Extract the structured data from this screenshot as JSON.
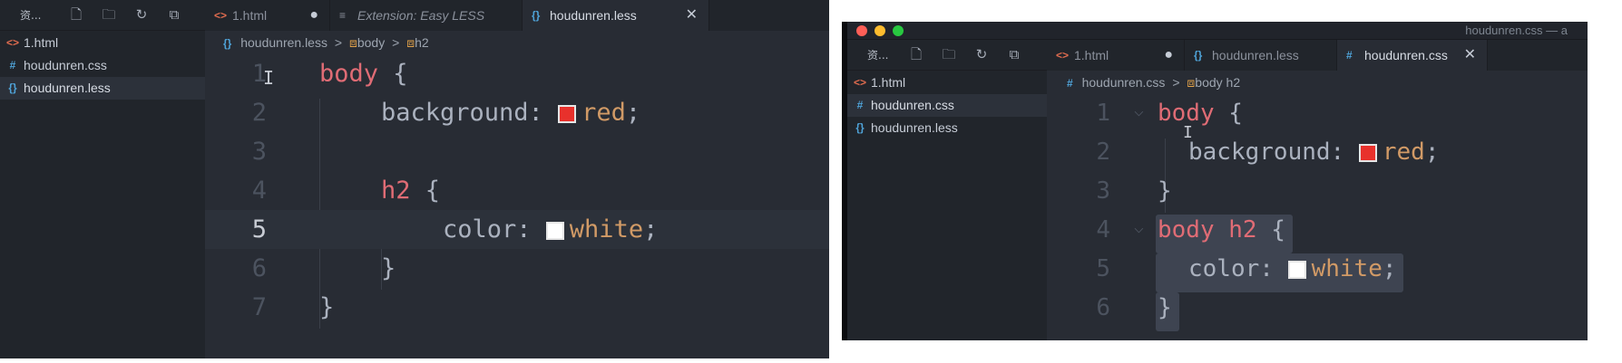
{
  "left": {
    "sidebar": {
      "title": "资...",
      "files": [
        {
          "name": "1.html",
          "icon": "<>",
          "icon_color": "#e06c4f"
        },
        {
          "name": "houdunren.css",
          "icon": "#",
          "icon_color": "#4fa3d8"
        },
        {
          "name": "houdunren.less",
          "icon": "{}",
          "icon_color": "#4fa3d8",
          "active": true
        }
      ]
    },
    "tabs": [
      {
        "label": "1.html",
        "icon": "<>",
        "icon_color": "#e06c4f",
        "status": "●"
      },
      {
        "label": "Extension: Easy LESS",
        "icon": "≡",
        "icon_color": "#8b919c",
        "italic": true
      },
      {
        "label": "houdunren.less",
        "icon": "{}",
        "icon_color": "#4fa3d8",
        "active": true,
        "status": "✕"
      }
    ],
    "breadcrumb": {
      "file": "houdunren.less",
      "sym1": "body",
      "sym2": "h2",
      "sep": ">"
    },
    "code": [
      {
        "n": "1",
        "indent": 0,
        "parts": [
          {
            "t": "body",
            "c": "tag"
          },
          {
            "t": " {",
            "c": "punct"
          }
        ]
      },
      {
        "n": "2",
        "indent": 1,
        "parts": [
          {
            "t": "background: ",
            "c": "prop"
          },
          {
            "sw": "#e8312c"
          },
          {
            "t": "red",
            "c": "val"
          },
          {
            "t": ";",
            "c": "punct"
          }
        ]
      },
      {
        "n": "3",
        "indent": 0,
        "parts": []
      },
      {
        "n": "4",
        "indent": 1,
        "parts": [
          {
            "t": "h2",
            "c": "tag"
          },
          {
            "t": " {",
            "c": "punct"
          }
        ]
      },
      {
        "n": "5",
        "indent": 2,
        "parts": [
          {
            "t": "color: ",
            "c": "prop"
          },
          {
            "sw": "#ffffff"
          },
          {
            "t": "white",
            "c": "val"
          },
          {
            "t": ";",
            "c": "punct"
          }
        ],
        "current": true
      },
      {
        "n": "6",
        "indent": 1,
        "parts": [
          {
            "t": "}",
            "c": "punct"
          }
        ]
      },
      {
        "n": "7",
        "indent": 0,
        "parts": [
          {
            "t": "}",
            "c": "punct"
          }
        ]
      }
    ]
  },
  "right": {
    "window_title": "houdunren.css — a",
    "sidebar": {
      "title": "资...",
      "files": [
        {
          "name": "1.html",
          "icon": "<>",
          "icon_color": "#e06c4f"
        },
        {
          "name": "houdunren.css",
          "icon": "#",
          "icon_color": "#4fa3d8",
          "active": true
        },
        {
          "name": "houdunren.less",
          "icon": "{}",
          "icon_color": "#4fa3d8"
        }
      ]
    },
    "tabs": [
      {
        "label": "1.html",
        "icon": "<>",
        "icon_color": "#e06c4f",
        "status": "●"
      },
      {
        "label": "houdunren.less",
        "icon": "{}",
        "icon_color": "#4fa3d8"
      },
      {
        "label": "houdunren.css",
        "icon": "#",
        "icon_color": "#4fa3d8",
        "active": true,
        "status": "✕"
      }
    ],
    "breadcrumb": {
      "file": "houdunren.css",
      "sym1": "body h2",
      "sep": ">"
    },
    "code": [
      {
        "n": "1",
        "indent": 0,
        "parts": [
          {
            "t": "body",
            "c": "tag"
          },
          {
            "t": " {",
            "c": "punct"
          }
        ]
      },
      {
        "n": "2",
        "indent": 1,
        "parts": [
          {
            "t": "background: ",
            "c": "prop"
          },
          {
            "sw": "#e8312c"
          },
          {
            "t": "red",
            "c": "val"
          },
          {
            "t": ";",
            "c": "punct"
          }
        ]
      },
      {
        "n": "3",
        "indent": 0,
        "parts": [
          {
            "t": "}",
            "c": "punct"
          }
        ]
      },
      {
        "n": "4",
        "indent": 0,
        "parts": [
          {
            "t": "body h2",
            "c": "tag"
          },
          {
            "t": " {",
            "c": "punct"
          }
        ],
        "selected": true
      },
      {
        "n": "5",
        "indent": 1,
        "parts": [
          {
            "t": "color: ",
            "c": "prop"
          },
          {
            "sw": "#ffffff"
          },
          {
            "t": "white",
            "c": "val"
          },
          {
            "t": ";",
            "c": "punct"
          }
        ],
        "selected": true
      },
      {
        "n": "6",
        "indent": 0,
        "parts": [
          {
            "t": "}",
            "c": "punct"
          }
        ],
        "selected": true
      }
    ]
  },
  "colors": {
    "accent_active_tab": "#282c34",
    "tag": "#e06c75",
    "value": "#d19a66",
    "selection": "#3e4451"
  }
}
